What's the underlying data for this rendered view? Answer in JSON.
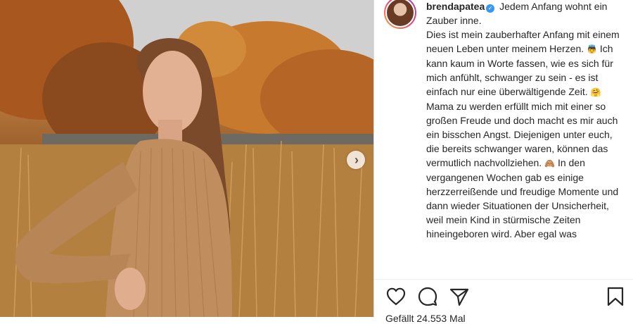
{
  "post": {
    "username": "brendapatea",
    "verified": true,
    "caption": {
      "first_line": "Jedem Anfang wohnt ein Zauber inne.",
      "para_1": "Dies ist mein zauberhafter Anfang mit einem neuen Leben unter meinem Herzen.",
      "emoji_1": "👼",
      "para_2": "Ich kann kaum in Worte fassen, wie es sich für mich anfühlt, schwanger zu sein - es ist einfach nur eine überwältigende Zeit.",
      "emoji_2": "🤗",
      "para_3": "Mama zu werden erfüllt mich mit einer so großen Freude und doch macht es mir auch ein bisschen Angst. Diejenigen unter euch, die bereits schwanger waren, können das vermutlich nachvollziehen.",
      "emoji_3": "🙈",
      "para_4": "In den vergangenen Wochen gab es einige herzzerreißende und freudige Momente und dann wieder Situationen der Unsicherheit, weil mein Kind in stürmische Zeiten hineingeboren wird. Aber egal was"
    },
    "likes_text": "Gefällt 24.553 Mal"
  },
  "icons": {
    "like": "heart-icon",
    "comment": "comment-icon",
    "share": "send-icon",
    "save": "bookmark-icon",
    "next": "chevron-right-icon"
  },
  "colors": {
    "text": "#262626",
    "verified": "#3897f0",
    "divider": "#dbdbdb"
  }
}
